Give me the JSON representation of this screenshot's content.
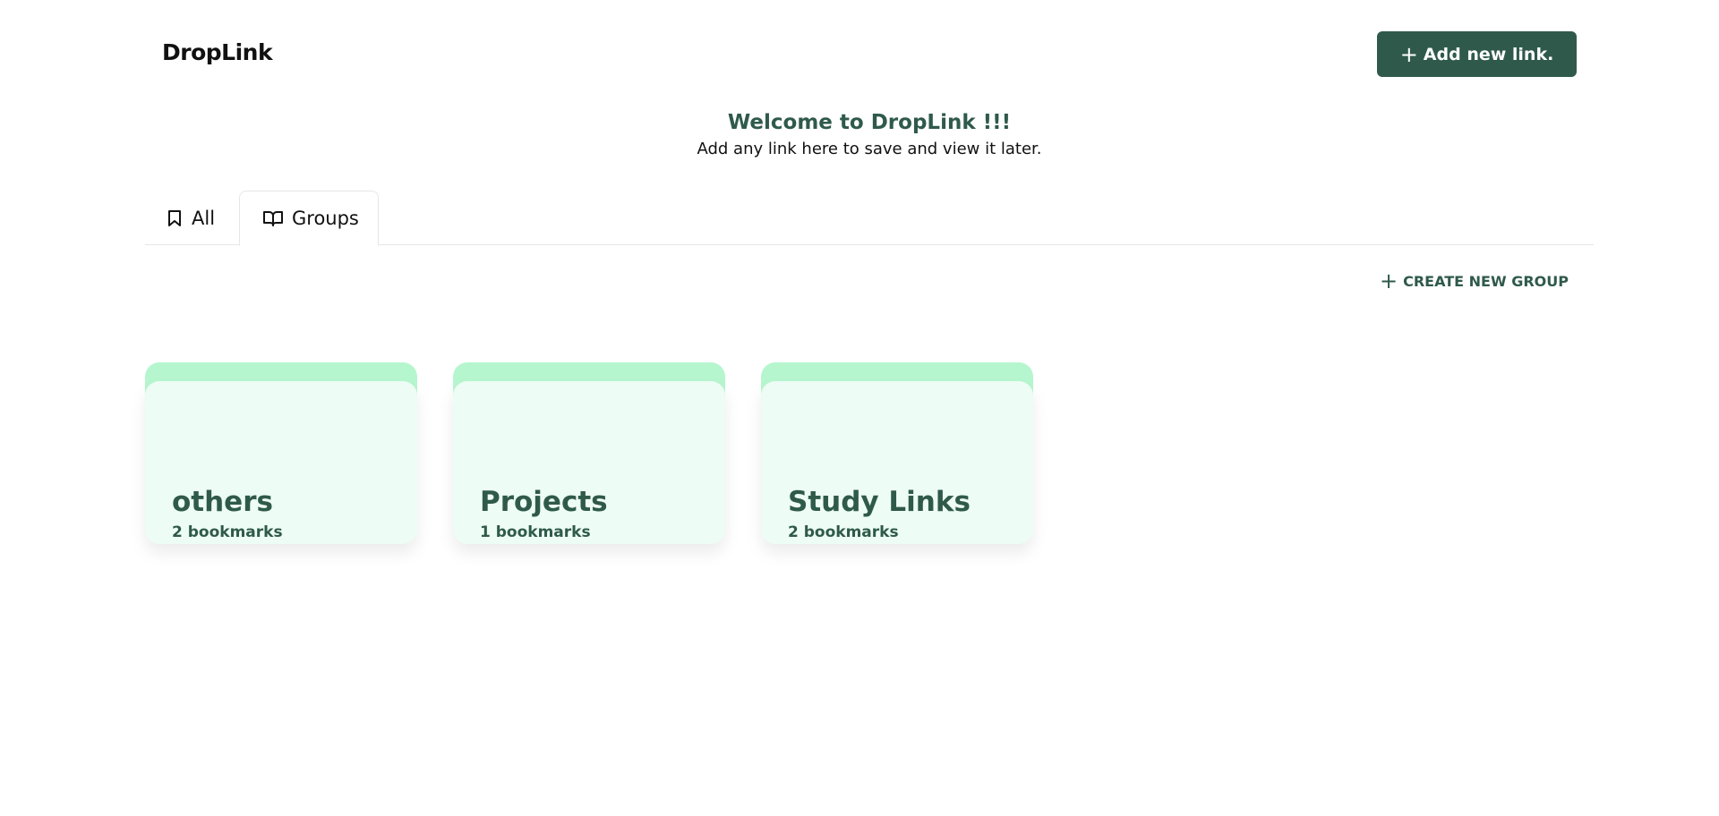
{
  "header": {
    "brand": "DropLink",
    "add_button_label": "Add new link."
  },
  "welcome": {
    "title": "Welcome to DropLink !!!",
    "subtitle": "Add any link here to save and view it later."
  },
  "tabs": [
    {
      "label": "All",
      "icon": "bookmark-icon"
    },
    {
      "label": "Groups",
      "icon": "book-open-icon",
      "active": true
    }
  ],
  "create_group_label": "CREATE NEW GROUP",
  "groups": [
    {
      "name": "others",
      "count": "2 bookmarks"
    },
    {
      "name": "Projects",
      "count": "1 bookmarks"
    },
    {
      "name": "Study Links",
      "count": "2 bookmarks"
    }
  ],
  "colors": {
    "accent": "#2f5a4b",
    "card_tab": "#b6f6cf",
    "card_body": "#edfcf4"
  }
}
